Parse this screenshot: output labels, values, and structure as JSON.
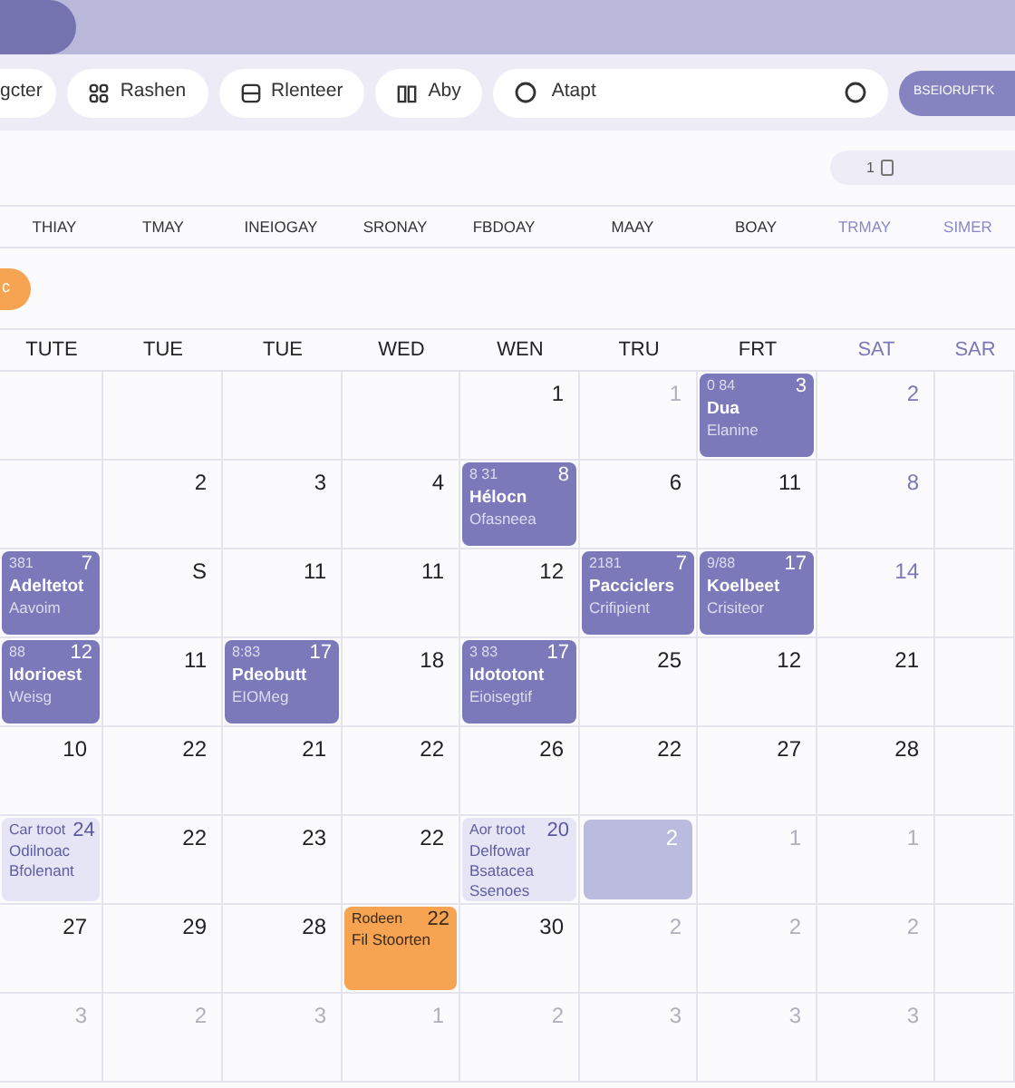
{
  "toolbar": {
    "chips": [
      "gcter",
      "Rashen",
      "Rlenteer",
      "Aby"
    ],
    "search": {
      "value": "Atapt"
    },
    "action_button": "BSEIORUFTK"
  },
  "view_pill": {
    "label": "1"
  },
  "week_strip": [
    {
      "label": "THIAY",
      "weekend": false
    },
    {
      "label": "TMAY",
      "weekend": false
    },
    {
      "label": "INEIOGAY",
      "weekend": false
    },
    {
      "label": "SRONAY",
      "weekend": false
    },
    {
      "label": "FBDOAY",
      "weekend": false
    },
    {
      "label": "MAAY",
      "weekend": false
    },
    {
      "label": "BOAY",
      "weekend": false
    },
    {
      "label": "TRMAY",
      "weekend": true
    },
    {
      "label": "SIMER",
      "weekend": true
    }
  ],
  "today_badge": "c",
  "calendar": {
    "columns": [
      {
        "label": "TUTE",
        "weekend": false
      },
      {
        "label": "TUE",
        "weekend": false
      },
      {
        "label": "TUE",
        "weekend": false
      },
      {
        "label": "WED",
        "weekend": false
      },
      {
        "label": "WEN",
        "weekend": false
      },
      {
        "label": "TRU",
        "weekend": false
      },
      {
        "label": "FRT",
        "weekend": false
      },
      {
        "label": "SAT",
        "weekend": true
      },
      {
        "label": "SAR",
        "weekend": true
      }
    ],
    "rows": [
      [
        {
          "kind": "empty"
        },
        {
          "kind": "empty"
        },
        {
          "kind": "empty"
        },
        {
          "kind": "empty"
        },
        {
          "kind": "day",
          "day": "1"
        },
        {
          "kind": "faded",
          "day": "1"
        },
        {
          "kind": "event",
          "time": "0 84",
          "day": "3",
          "lines": [
            "Dua",
            "Elanine"
          ]
        },
        {
          "kind": "weekend",
          "day": "2"
        },
        {
          "kind": "empty"
        }
      ],
      [
        {
          "kind": "empty"
        },
        {
          "kind": "day",
          "day": "2"
        },
        {
          "kind": "day",
          "day": "3"
        },
        {
          "kind": "day",
          "day": "4"
        },
        {
          "kind": "event",
          "time": "8 31",
          "day": "8",
          "lines": [
            "Hélocn",
            "Ofasneea"
          ]
        },
        {
          "kind": "day",
          "day": "6"
        },
        {
          "kind": "day",
          "day": "11"
        },
        {
          "kind": "weekend",
          "day": "8"
        },
        {
          "kind": "empty"
        }
      ],
      [
        {
          "kind": "event",
          "time": "381",
          "day": "7",
          "lines": [
            "Adeltetot",
            "Aavoim"
          ]
        },
        {
          "kind": "day",
          "day": "S"
        },
        {
          "kind": "day",
          "day": "11"
        },
        {
          "kind": "day",
          "day": "11"
        },
        {
          "kind": "day",
          "day": "12"
        },
        {
          "kind": "event",
          "time": "2181",
          "day": "7",
          "lines": [
            "Pacciclers",
            "Crifipient"
          ]
        },
        {
          "kind": "event",
          "time": "9/88",
          "day": "17",
          "lines": [
            "Koelbeet",
            "Crisiteor"
          ]
        },
        {
          "kind": "weekend",
          "day": "14"
        },
        {
          "kind": "empty"
        }
      ],
      [
        {
          "kind": "event",
          "time": "88",
          "day": "12",
          "lines": [
            "Idorioest",
            "Weisg"
          ]
        },
        {
          "kind": "day",
          "day": "11"
        },
        {
          "kind": "event",
          "time": "8:83",
          "day": "17",
          "lines": [
            "Pdeobutt",
            "EIOMeg"
          ]
        },
        {
          "kind": "day",
          "day": "18"
        },
        {
          "kind": "event",
          "time": "3 83",
          "day": "17",
          "lines": [
            "Idototont",
            "Eioisegtif"
          ]
        },
        {
          "kind": "day",
          "day": "25"
        },
        {
          "kind": "day",
          "day": "12"
        },
        {
          "kind": "day",
          "day": "21"
        },
        {
          "kind": "empty"
        }
      ],
      [
        {
          "kind": "day",
          "day": "10"
        },
        {
          "kind": "day",
          "day": "22"
        },
        {
          "kind": "day",
          "day": "21"
        },
        {
          "kind": "day",
          "day": "22"
        },
        {
          "kind": "day",
          "day": "26"
        },
        {
          "kind": "day",
          "day": "22"
        },
        {
          "kind": "day",
          "day": "27"
        },
        {
          "kind": "day",
          "day": "28"
        },
        {
          "kind": "empty"
        }
      ],
      [
        {
          "kind": "light_event",
          "time": "Car troot",
          "day": "24",
          "lines": [
            "Odilnoac",
            "Bfolenant"
          ]
        },
        {
          "kind": "day",
          "day": "22"
        },
        {
          "kind": "day",
          "day": "23"
        },
        {
          "kind": "day",
          "day": "22"
        },
        {
          "kind": "light_event",
          "time": "Aor troot",
          "day": "20",
          "lines": [
            "Delfowar",
            "Bsatacea",
            "Ssenoes"
          ]
        },
        {
          "kind": "highlight",
          "day": "2"
        },
        {
          "kind": "faded",
          "day": "1"
        },
        {
          "kind": "faded",
          "day": "1"
        },
        {
          "kind": "empty"
        }
      ],
      [
        {
          "kind": "day",
          "day": "27"
        },
        {
          "kind": "day",
          "day": "29"
        },
        {
          "kind": "day",
          "day": "28"
        },
        {
          "kind": "orange_event",
          "time": "Rodeen",
          "day": "22",
          "lines": [
            "Fil Stoorten"
          ]
        },
        {
          "kind": "day",
          "day": "30"
        },
        {
          "kind": "faded",
          "day": "2"
        },
        {
          "kind": "faded",
          "day": "2"
        },
        {
          "kind": "faded",
          "day": "2"
        },
        {
          "kind": "empty"
        }
      ],
      [
        {
          "kind": "faded",
          "day": "3"
        },
        {
          "kind": "faded",
          "day": "2"
        },
        {
          "kind": "faded",
          "day": "3"
        },
        {
          "kind": "faded",
          "day": "1"
        },
        {
          "kind": "faded",
          "day": "2"
        },
        {
          "kind": "faded",
          "day": "3"
        },
        {
          "kind": "faded",
          "day": "3"
        },
        {
          "kind": "faded",
          "day": "3"
        },
        {
          "kind": "empty"
        }
      ]
    ]
  }
}
